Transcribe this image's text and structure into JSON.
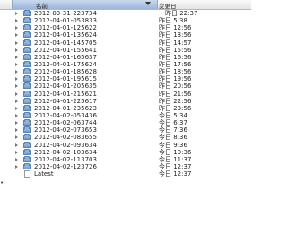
{
  "header": {
    "name_col": "名前",
    "date_col": "変更日"
  },
  "rows": [
    {
      "name": "2012-03-31-223734",
      "date": "一昨日 22:37",
      "kind": "folder"
    },
    {
      "name": "2012-04-01-053833",
      "date": "昨日 5:38",
      "kind": "folder"
    },
    {
      "name": "2012-04-01-125622",
      "date": "昨日 12:56",
      "kind": "folder"
    },
    {
      "name": "2012-04-01-135624",
      "date": "昨日 13:56",
      "kind": "folder"
    },
    {
      "name": "2012-04-01-145705",
      "date": "昨日 14:57",
      "kind": "folder"
    },
    {
      "name": "2012-04-01-155641",
      "date": "昨日 15:56",
      "kind": "folder"
    },
    {
      "name": "2012-04-01-165637",
      "date": "昨日 16:56",
      "kind": "folder"
    },
    {
      "name": "2012-04-01-175624",
      "date": "昨日 17:56",
      "kind": "folder"
    },
    {
      "name": "2012-04-01-185628",
      "date": "昨日 18:56",
      "kind": "folder"
    },
    {
      "name": "2012-04-01-195615",
      "date": "昨日 19:56",
      "kind": "folder"
    },
    {
      "name": "2012-04-01-205635",
      "date": "昨日 20:56",
      "kind": "folder"
    },
    {
      "name": "2012-04-01-215621",
      "date": "昨日 21:56",
      "kind": "folder"
    },
    {
      "name": "2012-04-01-225617",
      "date": "昨日 22:56",
      "kind": "folder"
    },
    {
      "name": "2012-04-01-235623",
      "date": "昨日 23:56",
      "kind": "folder"
    },
    {
      "name": "2012-04-02-053436",
      "date": "今日 5:34",
      "kind": "folder"
    },
    {
      "name": "2012-04-02-063744",
      "date": "今日 6:37",
      "kind": "folder"
    },
    {
      "name": "2012-04-02-073653",
      "date": "今日 7:36",
      "kind": "folder"
    },
    {
      "name": "2012-04-02-083655",
      "date": "今日 8:36",
      "kind": "folder"
    },
    {
      "name": "2012-04-02-093634",
      "date": "今日 9:36",
      "kind": "folder"
    },
    {
      "name": "2012-04-02-103634",
      "date": "今日 10:36",
      "kind": "folder"
    },
    {
      "name": "2012-04-02-113703",
      "date": "今日 11:37",
      "kind": "folder"
    },
    {
      "name": "2012-04-02-123726",
      "date": "今日 12:37",
      "kind": "folder"
    },
    {
      "name": "Latest",
      "date": "今日 12:37",
      "kind": "alias"
    }
  ],
  "edge_marker": "•"
}
